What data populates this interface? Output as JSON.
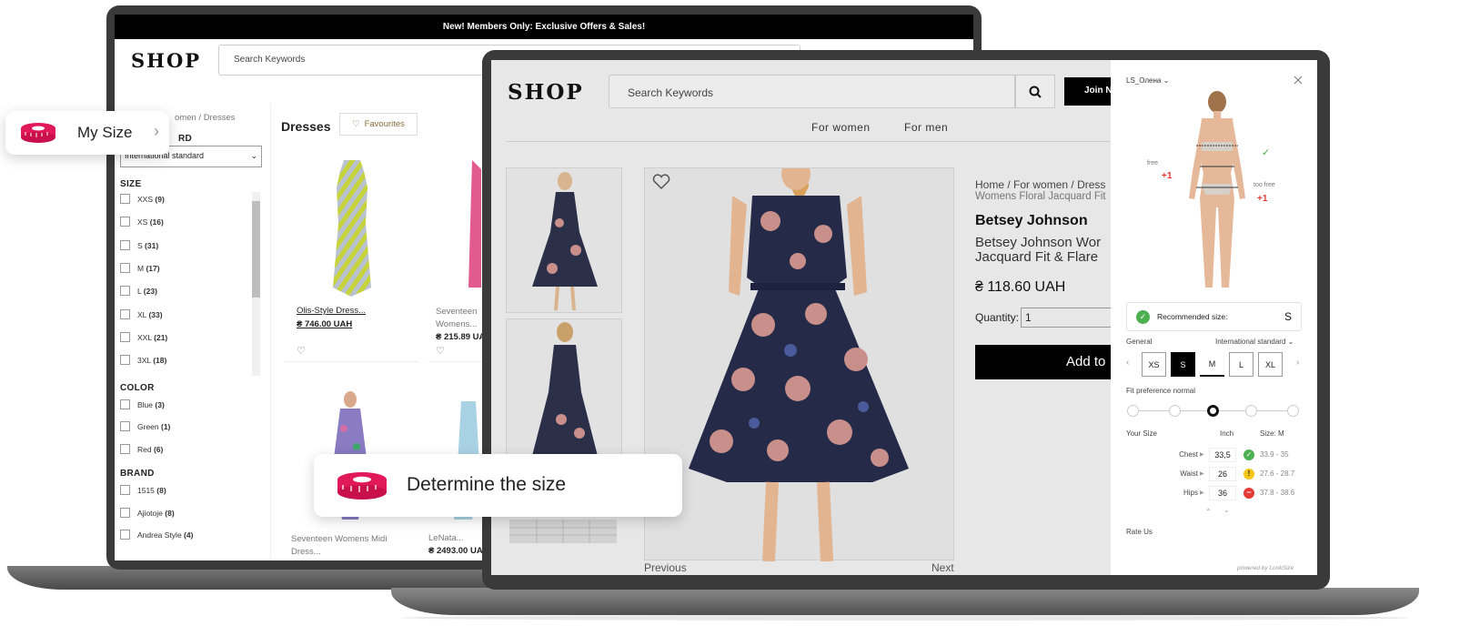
{
  "back": {
    "banner": "New! Members Only: Exclusive Offers & Sales!",
    "logo": "SHOP",
    "search_placeholder": "Search Keywords",
    "breadcrumb_partial": "omen",
    "breadcrumb_current": "Dresses",
    "size_standard_label": "RD",
    "size_standard_value": "International standard",
    "size_title": "SIZE",
    "sizes": [
      {
        "label": "XXS",
        "count": "(9)"
      },
      {
        "label": "XS",
        "count": "(16)"
      },
      {
        "label": "S",
        "count": "(31)"
      },
      {
        "label": "M",
        "count": "(17)"
      },
      {
        "label": "L",
        "count": "(23)"
      },
      {
        "label": "XL",
        "count": "(33)"
      },
      {
        "label": "XXL",
        "count": "(21)"
      },
      {
        "label": "3XL",
        "count": "(18)"
      }
    ],
    "color_title": "COLOR",
    "colors": [
      {
        "label": "Blue",
        "count": "(3)"
      },
      {
        "label": "Green",
        "count": "(1)"
      },
      {
        "label": "Red",
        "count": "(6)"
      }
    ],
    "brand_title": "BRAND",
    "brands": [
      {
        "label": "1515",
        "count": "(8)"
      },
      {
        "label": "Ajiotoje",
        "count": "(8)"
      },
      {
        "label": "Andrea Style",
        "count": "(4)"
      }
    ],
    "page_title": "Dresses",
    "favourites_label": "Favourites",
    "products": [
      {
        "name": "Olis-Style Dress...",
        "price": "₴ 746.00 UAH"
      },
      {
        "name": "Seventeen Womens...",
        "price": "₴ 215.89 UA"
      },
      {
        "name": "Seventeen Womens Midi Dress...",
        "price": ""
      },
      {
        "name": "LeNata...",
        "price": "₴ 2493.00 UAH"
      }
    ]
  },
  "front": {
    "logo": "SHOP",
    "search_placeholder": "Search Keywords",
    "join_label": "Join N",
    "nav": [
      "For women",
      "For men"
    ],
    "breadcrumb": [
      "Home",
      "For women",
      "Dress"
    ],
    "breadcrumb_sub": "Womens Floral Jacquard Fit",
    "brand": "Betsey Johnson",
    "title_line1": "Betsey Johnson Wor",
    "title_line2": "Jacquard Fit & Flare",
    "price": "₴ 118.60 UAH",
    "quantity_label": "Quantity:",
    "quantity_value": "1",
    "add_label": "Add to",
    "prev_label": "Previous",
    "next_label": "Next"
  },
  "widget": {
    "user": "LS_Олена",
    "label_free": "free",
    "label_too_free": "too free",
    "plus_left": "+1",
    "plus_right": "+1",
    "recommended_label": "Recommended size:",
    "recommended_size": "S",
    "general_label": "General",
    "standard_label": "International standard",
    "sizes": [
      "XS",
      "S",
      "M",
      "L",
      "XL"
    ],
    "selected_size": "S",
    "fit_label": "Fit preference normal",
    "your_size_label": "Your Size",
    "unit_label": "Inch",
    "size_col_label": "Size: M",
    "rows": [
      {
        "name": "Chest",
        "value": "33,5",
        "range": "33.9 - 35",
        "status": "ok"
      },
      {
        "name": "Waist",
        "value": "26",
        "range": "27.6 - 28.7",
        "status": "warn"
      },
      {
        "name": "Hips",
        "value": "36",
        "range": "37.8 - 38.6",
        "status": "bad"
      }
    ],
    "rate_label": "Rate Us",
    "powered": "powered by LookSize"
  },
  "pills": {
    "my_size": "My Size",
    "determine": "Determine the size"
  },
  "colors": {
    "accent": "#e1195a",
    "ok": "#4caf50",
    "warn": "#f5c518",
    "bad": "#e53935"
  }
}
